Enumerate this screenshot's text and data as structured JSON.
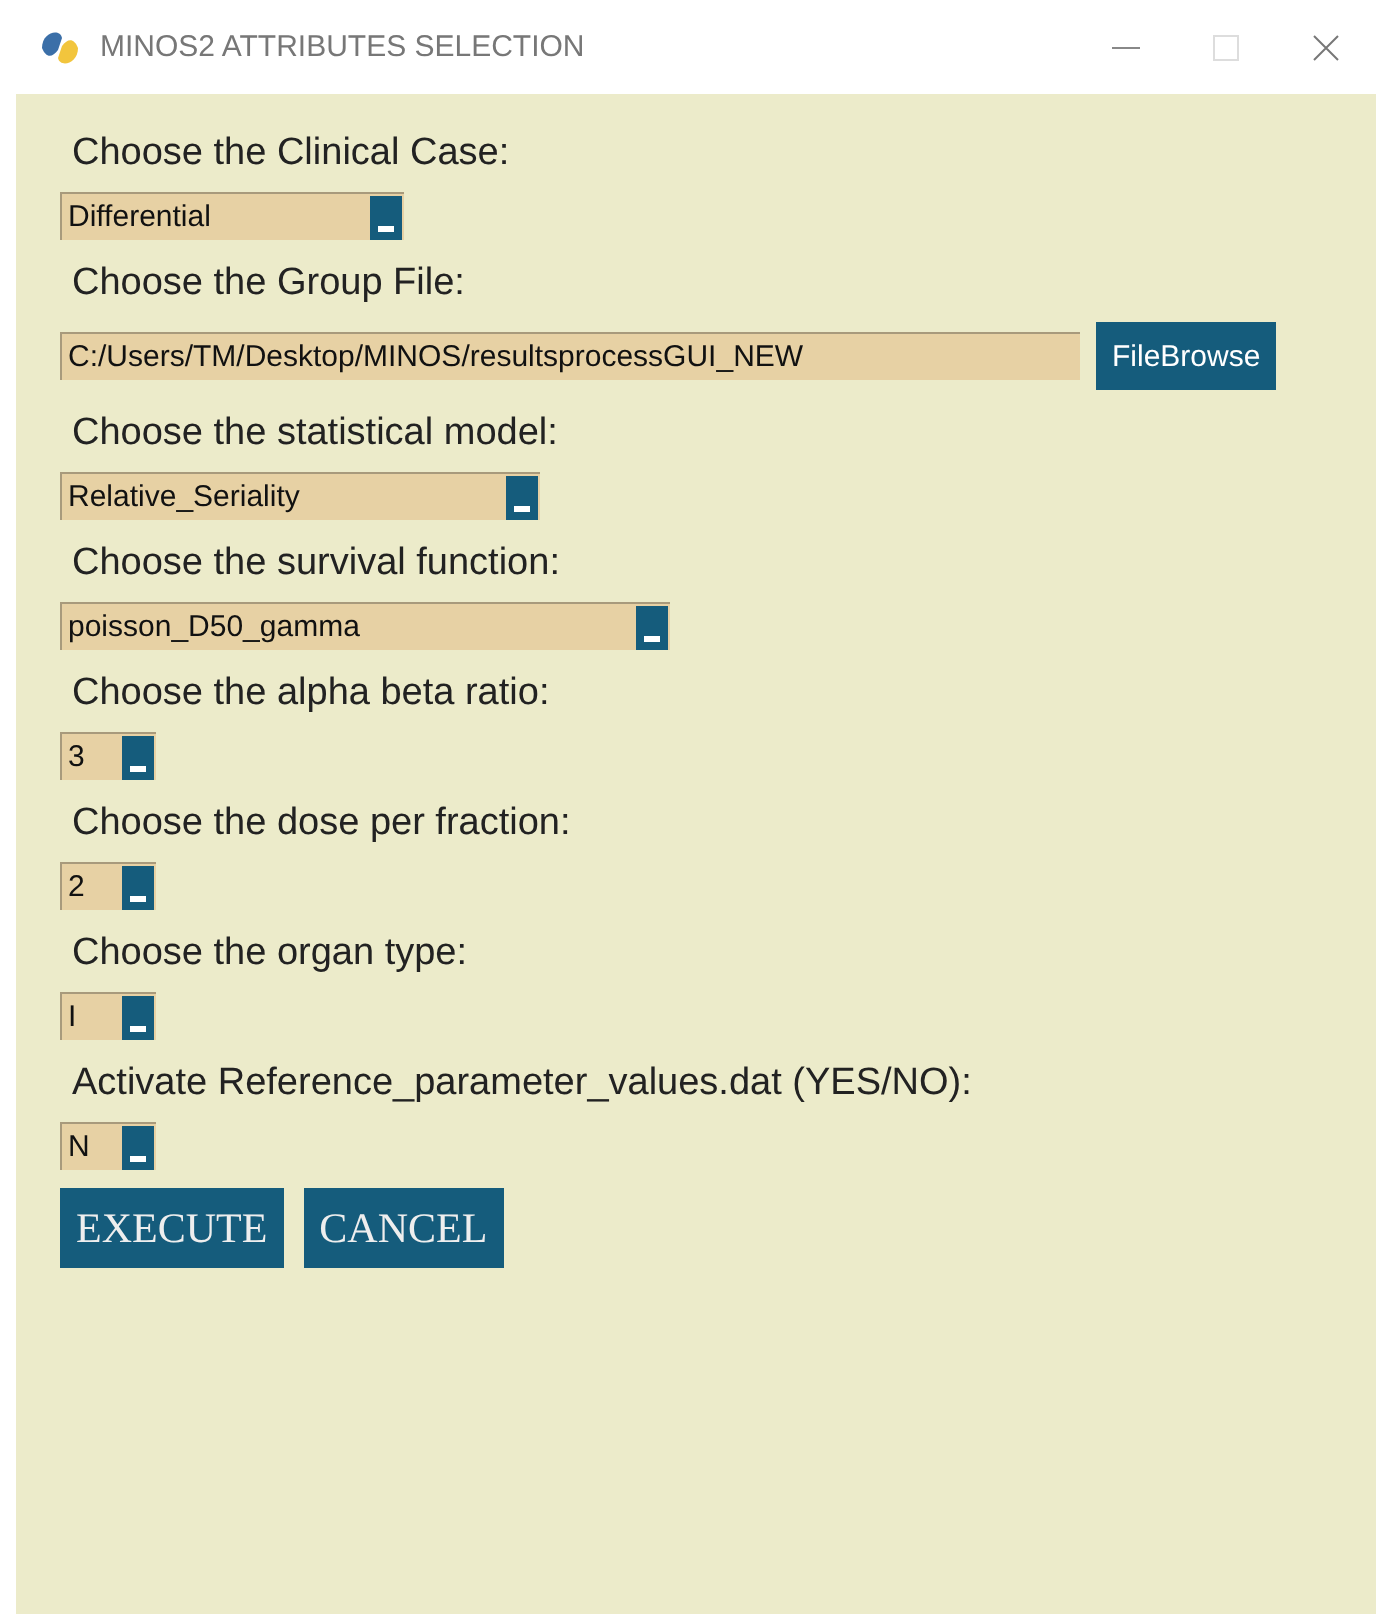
{
  "window": {
    "title": "MINOS2 ATTRIBUTES SELECTION"
  },
  "fields": [
    {
      "kind": "dropdown",
      "label": "Choose the Clinical Case:",
      "value": "Differential"
    },
    {
      "kind": "file",
      "label": "Choose the Group File:",
      "value": "C:/Users/TM/Desktop/MINOS/resultsprocessGUI_NEW",
      "button": "FileBrowse"
    },
    {
      "kind": "dropdown",
      "label": "Choose the statistical model:",
      "value": "Relative_Seriality"
    },
    {
      "kind": "dropdown",
      "label": "Choose the survival function:",
      "value": "poisson_D50_gamma"
    },
    {
      "kind": "dropdown",
      "label": "Choose the alpha beta ratio:",
      "value": "3"
    },
    {
      "kind": "dropdown",
      "label": "Choose the dose per fraction:",
      "value": "2"
    },
    {
      "kind": "dropdown",
      "label": "Choose the organ type:",
      "value": "I"
    },
    {
      "kind": "dropdown",
      "label": "Activate Reference_parameter_values.dat (YES/NO):",
      "value": "N"
    }
  ],
  "buttons": [
    "EXECUTE",
    "CANCEL"
  ]
}
